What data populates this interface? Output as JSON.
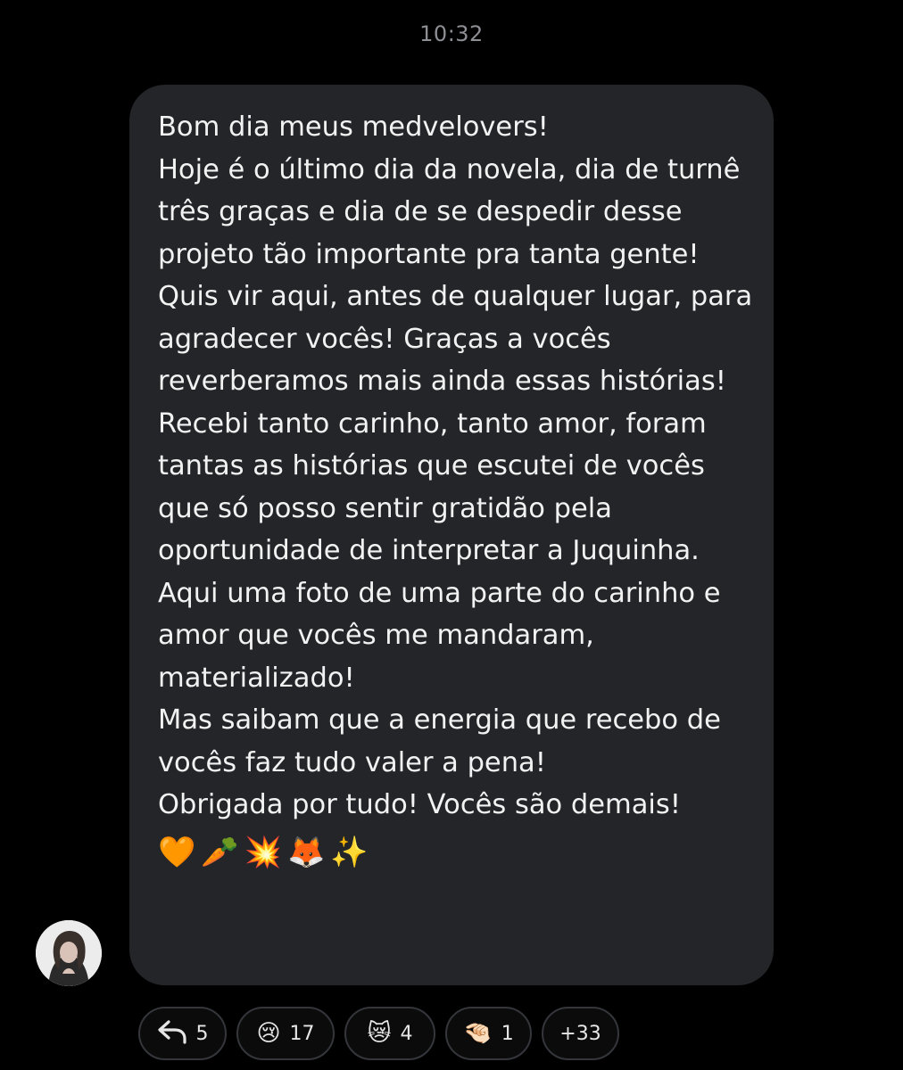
{
  "timestamp": "10:32",
  "message": {
    "paragraphs": [
      "Bom dia meus medvelovers!",
      "Hoje é o último dia da novela, dia de turnê três graças e dia de se despedir desse projeto tão importante pra tanta gente!",
      "Quis vir aqui, antes de qualquer lugar, para agradecer vocês! Graças a vocês reverberamos mais ainda essas histórias! Recebi tanto carinho, tanto amor, foram tantas as histórias que escutei de vocês que só posso sentir gratidão pela oportunidade de interpretar a Juquinha.",
      "Aqui uma foto de uma parte do carinho e amor que vocês me mandaram, materializado!",
      "Mas saibam que a energia que recebo de vocês faz tudo valer a pena!",
      "Obrigada por tudo! Vocês são demais!"
    ],
    "emojis": "🧡🥕💥🦊✨"
  },
  "reactions": {
    "reply": {
      "icon": "reply-arrow-icon",
      "count": "5"
    },
    "items": [
      {
        "emoji": "😢",
        "count": "17"
      },
      {
        "emoji": "😿",
        "count": "4"
      },
      {
        "emoji": "🤏🏻",
        "count": "1"
      }
    ],
    "more": "+33"
  },
  "colors": {
    "background": "#000000",
    "bubble": "#232529",
    "timestamp": "#8d8f95",
    "chip_border": "#34363b"
  }
}
